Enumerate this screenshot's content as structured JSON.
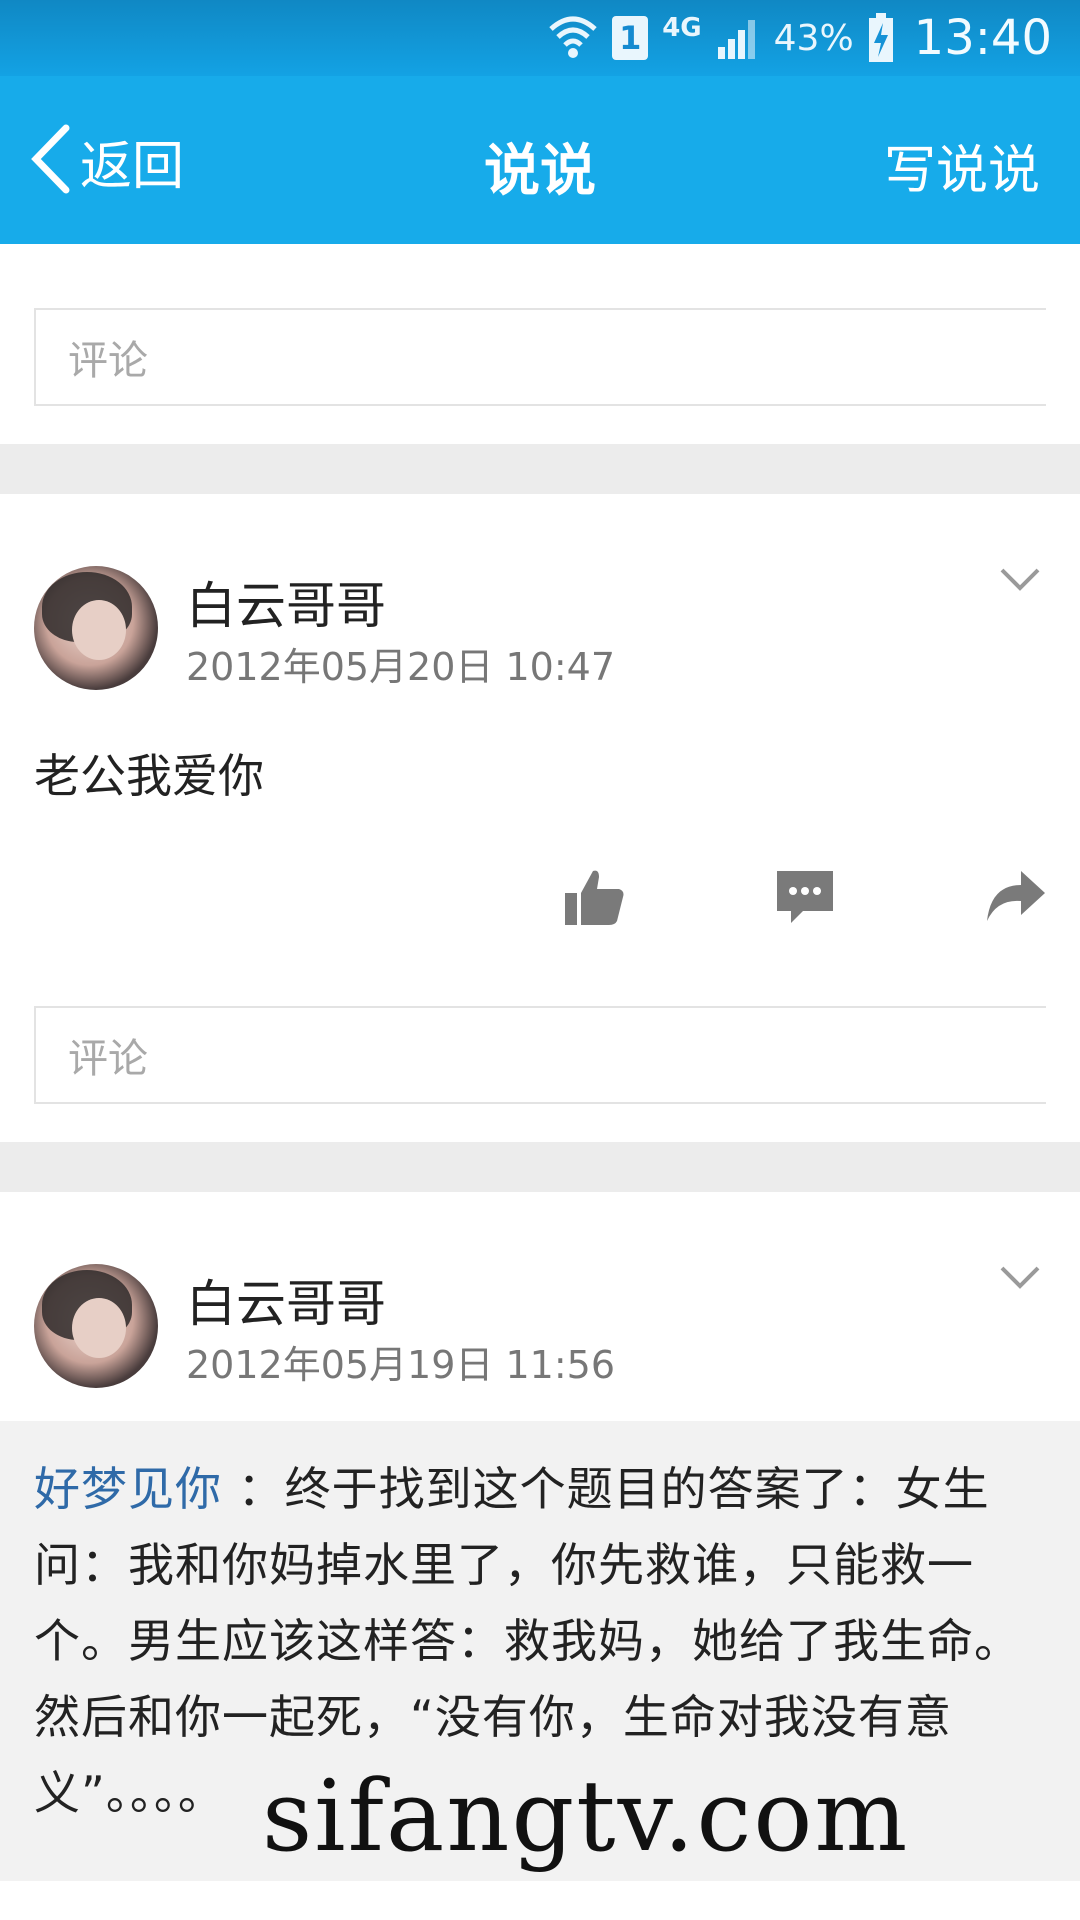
{
  "status_bar": {
    "sim": "1",
    "network": "4G",
    "battery": "43%",
    "time": "13:40"
  },
  "app_bar": {
    "back_label": "返回",
    "title": "说说",
    "write_label": "写说说"
  },
  "comment_placeholder": "评论",
  "posts": [
    {
      "author": "白云哥哥",
      "time": "2012年05月20日 10:47",
      "text": "老公我爱你"
    },
    {
      "author": "白云哥哥",
      "time": "2012年05月19日 11:56",
      "repost_author": "好梦见你",
      "repost_text": "：终于找到这个题目的答案了：女生问：我和你妈掉水里了，你先救谁，只能救一个。男生应该这样答：救我妈，她给了我生命。然后和你一起死，“没有你，生命对我没有意义”。。。。"
    }
  ],
  "watermark": "sifangtv.com",
  "colors": {
    "app_bar": "#17abea",
    "repost_author": "#2f6aa8",
    "separator": "#ececec"
  },
  "icons": [
    "wifi-icon",
    "sim-icon",
    "signal-icon",
    "battery-icon",
    "back-chevron-icon",
    "chevron-down-icon",
    "thumbs-up-icon",
    "comment-icon",
    "share-icon"
  ]
}
